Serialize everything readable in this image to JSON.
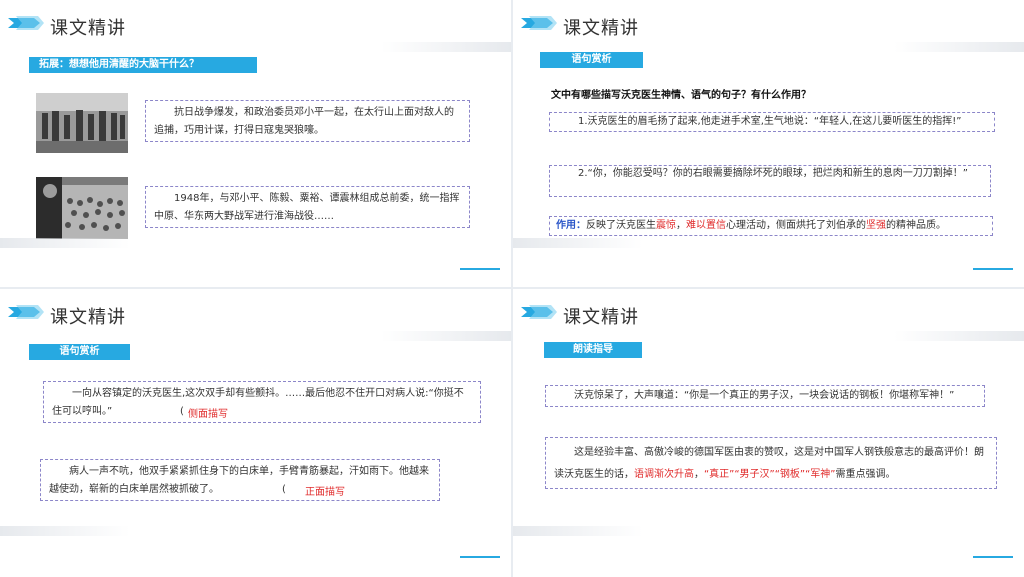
{
  "slide1": {
    "title": "课文精讲",
    "banner": "拓展：想想他用清醒的大脑干什么？",
    "box1": "抗日战争爆发，和政治委员邓小平一起，在太行山上面对敌人的追捕，巧用计谋，打得日寇鬼哭狼嚎。",
    "box2": "1948年，与邓小平、陈毅、粟裕、谭震林组成总前委，统一指挥中原、华东两大野战军进行淮海战役……"
  },
  "slide2": {
    "title": "课文精讲",
    "banner": "语句赏析",
    "question": "文中有哪些描写沃克医生神情、语气的句子？有什么作用？",
    "item1": "1.沃克医生的眉毛扬了起来,他走进手术室,生气地说：“年轻人,在这儿要听医生的指挥!”",
    "item2": "2.“你，你能忍受吗？你的右眼需要摘除坏死的眼球，把烂肉和新生的息肉一刀刀割掉！”",
    "effect_label": "作用：",
    "effect_p1": "反映了沃克医生",
    "effect_r1": "震惊",
    "effect_p2": "，",
    "effect_r2": "难以置信",
    "effect_p3": "心理活动，侧面烘托了刘伯承的",
    "effect_r3": "坚强",
    "effect_p4": "的精神品质。"
  },
  "slide3": {
    "title": "课文精讲",
    "banner": "语句赏析",
    "box1": "一向从容镇定的沃克医生,这次双手却有些颤抖。……最后他忍不住开口对病人说:“你挺不住可以哼叫。”",
    "note1_paren": "(",
    "note1": "侧面描写",
    "box2": "病人一声不吭，他双手紧紧抓住身下的白床单，手臂青筋暴起，汗如雨下。他越来越使劲，崭新的白床单居然被抓破了。",
    "note2_paren": "(",
    "note2": "正面描写"
  },
  "slide4": {
    "title": "课文精讲",
    "banner": "朗读指导",
    "box1": "沃克惊呆了，大声嚷道：“你是一个真正的男子汉，一块会说话的钢板！你堪称军神！”",
    "box2_p1": "这是经验丰富、高傲冷峻的德国军医由衷的赞叹，这是对中国军人钢铁般意志的最高评价！朗读沃克医生的话，",
    "box2_r1": "语调渐次升高",
    "box2_p2": "，",
    "box2_r2": "“真正”“男子汉”“钢板”“军神”",
    "box2_p3": "需重点强调。"
  },
  "colors": {
    "accent": "#27a9e1",
    "highlight": "#e02b2b",
    "border": "#8c86c9"
  }
}
